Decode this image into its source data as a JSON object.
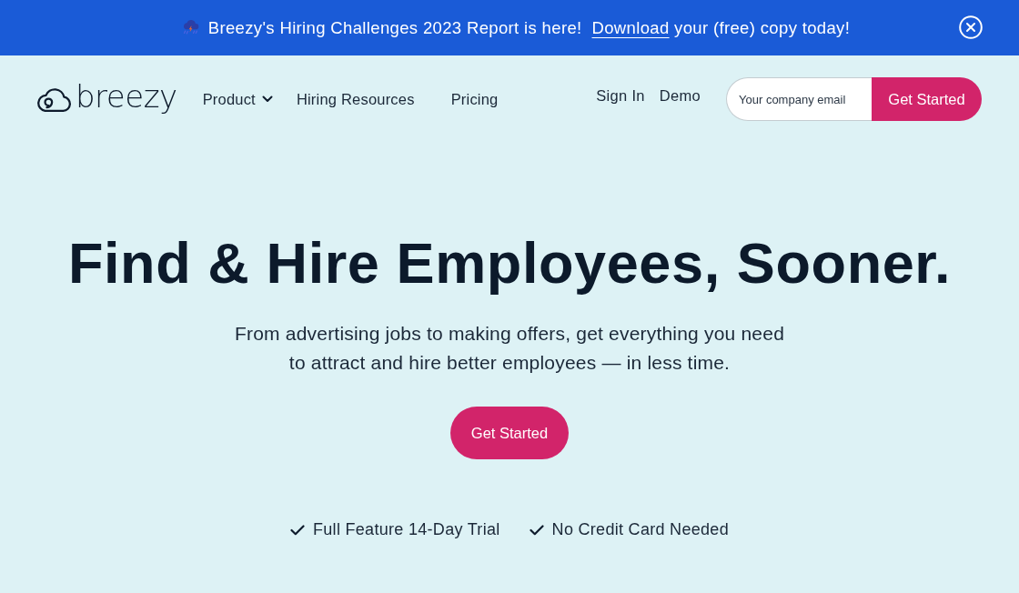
{
  "banner": {
    "text_before": "Breezy's Hiring Challenges 2023 Report is here!",
    "link": "Download",
    "text_after": "your (free) copy today!"
  },
  "nav": {
    "logo": "breezy",
    "items": [
      {
        "label": "Product",
        "kind": "dropdown"
      },
      {
        "label": "Hiring Resources",
        "kind": "link"
      },
      {
        "label": "Pricing",
        "kind": "link"
      }
    ],
    "account_links": [
      "Sign In",
      "Demo"
    ],
    "signup": {
      "placeholder": "Your company email",
      "button": "Get Started"
    }
  },
  "hero": {
    "title": "Find & Hire Employees, Sooner.",
    "subtitle": "From advertising jobs to making offers, get everything you need to attract and hire better employees — in less time.",
    "button": "Get Started",
    "features": [
      "Full Feature 14-Day Trial",
      "No Credit Card Needed"
    ]
  }
}
